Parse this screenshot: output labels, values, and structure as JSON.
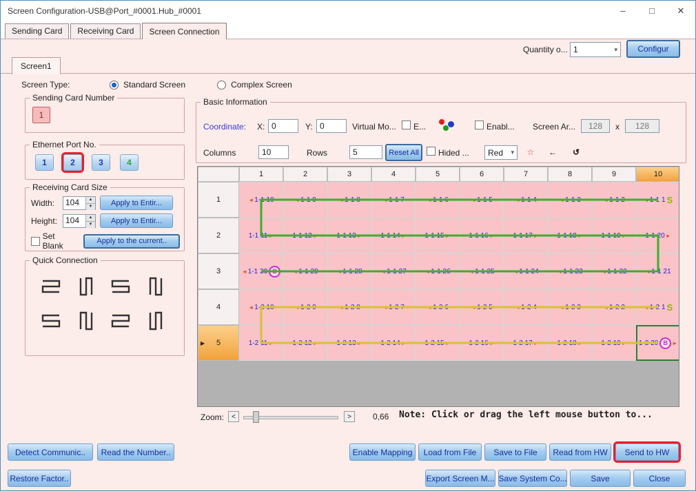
{
  "window": {
    "title": "Screen Configuration-USB@Port_#0001.Hub_#0001",
    "controls": {
      "minimize": "–",
      "maximize": "□",
      "close": "✕"
    }
  },
  "main_tabs": [
    "Sending Card",
    "Receiving Card",
    "Screen Connection"
  ],
  "header": {
    "quantity_label": "Quantity o...",
    "quantity_value": "1",
    "configure_button": "Configur"
  },
  "screen_tab": "Screen1",
  "screen_type": {
    "label": "Screen Type:",
    "standard": "Standard Screen",
    "complex": "Complex Screen"
  },
  "sending_card": {
    "legend": "Sending Card Number",
    "button": "1"
  },
  "ethernet": {
    "legend": "Ethernet Port No.",
    "ports": [
      "1",
      "2",
      "3",
      "4"
    ],
    "port_colors": [
      "#1c3cb4",
      "#1c3cb4",
      "#1c3cb4",
      "#2f9e44"
    ],
    "selected_index": 1
  },
  "card_size": {
    "legend": "Receiving Card Size",
    "width_label": "Width:",
    "width": "104",
    "apply_width": "Apply to Entir...",
    "height_label": "Height:",
    "height": "104",
    "apply_height": "Apply to Entir...",
    "set_blank": "Set Blank",
    "apply_current": "Apply to the current.."
  },
  "quick_connection": {
    "legend": "Quick Connection",
    "icons": [
      "z-right-down",
      "n-down-right",
      "z-left-down",
      "n-down-left",
      "z-right-up",
      "n-up-right",
      "z-left-up",
      "n-up-left"
    ]
  },
  "basic": {
    "legend": "Basic Information",
    "coordinate_label": "Coordinate:",
    "x_label": "X:",
    "x_value": "0",
    "y_label": "Y:",
    "y_value": "0",
    "virtual_label": "Virtual Mo...",
    "e_checkbox_label": "E...",
    "enable_checkbox_label": "Enabl...",
    "screen_area_label": "Screen Ar...",
    "area_width": "128",
    "area_times": "x",
    "area_height": "128",
    "columns_label": "Columns",
    "columns_value": "10",
    "rows_label": "Rows",
    "rows_value": "5",
    "reset_button": "Reset All",
    "hided_label": "Hided ...",
    "color_value": "Red"
  },
  "grid": {
    "col_headers": [
      "1",
      "2",
      "3",
      "4",
      "5",
      "6",
      "7",
      "8",
      "9",
      "10"
    ],
    "selected_col": 9,
    "rows": [
      {
        "header": "1",
        "flow": "left",
        "cells": [
          {
            "t": "1-1 10"
          },
          {
            "t": "1-1 9"
          },
          {
            "t": "1-1 8"
          },
          {
            "t": "1-1 7"
          },
          {
            "t": "1-1 6"
          },
          {
            "t": "1-1 5"
          },
          {
            "t": "1-1 4"
          },
          {
            "t": "1-1 3"
          },
          {
            "t": "1-1 2"
          },
          {
            "t": "1-1 1",
            "m": "S"
          }
        ]
      },
      {
        "header": "2",
        "flow": "right",
        "cells": [
          {
            "t": "1-1 11"
          },
          {
            "t": "1-1 12"
          },
          {
            "t": "1-1 13"
          },
          {
            "t": "1-1 14"
          },
          {
            "t": "1-1 15"
          },
          {
            "t": "1-1 16"
          },
          {
            "t": "1-1 17"
          },
          {
            "t": "1-1 18"
          },
          {
            "t": "1-1 19"
          },
          {
            "t": "1-1 20"
          }
        ]
      },
      {
        "header": "3",
        "flow": "left",
        "cells": [
          {
            "t": "1-1 30",
            "m": "B"
          },
          {
            "t": "1-1 29"
          },
          {
            "t": "1-1 28"
          },
          {
            "t": "1-1 27"
          },
          {
            "t": "1-1 26"
          },
          {
            "t": "1-1 25"
          },
          {
            "t": "1-1 24"
          },
          {
            "t": "1-1 23"
          },
          {
            "t": "1-1 22"
          },
          {
            "t": "1-1 21"
          }
        ]
      },
      {
        "header": "4",
        "flow": "left",
        "cells": [
          {
            "t": "1-2 10"
          },
          {
            "t": "1-2 9"
          },
          {
            "t": "1-2 8"
          },
          {
            "t": "1-2 7"
          },
          {
            "t": "1-2 6"
          },
          {
            "t": "1-2 5"
          },
          {
            "t": "1-2 4"
          },
          {
            "t": "1-2 3"
          },
          {
            "t": "1-2 2"
          },
          {
            "t": "1-2 1",
            "m": "S"
          }
        ]
      },
      {
        "header": "5",
        "flow": "right",
        "selected": true,
        "selected_cell": 9,
        "cells": [
          {
            "t": "1-2 11"
          },
          {
            "t": "1-2 12"
          },
          {
            "t": "1-2 13"
          },
          {
            "t": "1-2 14"
          },
          {
            "t": "1-2 15"
          },
          {
            "t": "1-2 16"
          },
          {
            "t": "1-2 17"
          },
          {
            "t": "1-2 18"
          },
          {
            "t": "1-2 19"
          },
          {
            "t": "1-2 20",
            "m": "B"
          }
        ]
      }
    ],
    "paths": [
      {
        "color": "#3dae2b",
        "cells": [
          [
            0,
            9
          ],
          [
            0,
            0
          ],
          [
            1,
            0
          ],
          [
            1,
            9
          ],
          [
            2,
            9
          ],
          [
            2,
            0
          ]
        ]
      },
      {
        "color": "#d8c22e",
        "cells": [
          [
            3,
            9
          ],
          [
            3,
            0
          ],
          [
            4,
            0
          ],
          [
            4,
            9
          ]
        ]
      }
    ]
  },
  "zoom": {
    "label": "Zoom:",
    "decrease": "<",
    "increase": ">",
    "value": "0,66",
    "note": "Note: Click or drag the left mouse button to..."
  },
  "actions": {
    "detect": "Detect Communic..",
    "read_number": "Read the Number..",
    "enable_mapping": "Enable Mapping",
    "load_from_file": "Load from File",
    "save_to_file": "Save to File",
    "read_from_hw": "Read from HW",
    "send_to_hw": "Send to HW",
    "restore": "Restore Factor..",
    "export_screen": "Export Screen M...",
    "save_system": "Save System Co...",
    "save": "Save",
    "close": "Close"
  }
}
